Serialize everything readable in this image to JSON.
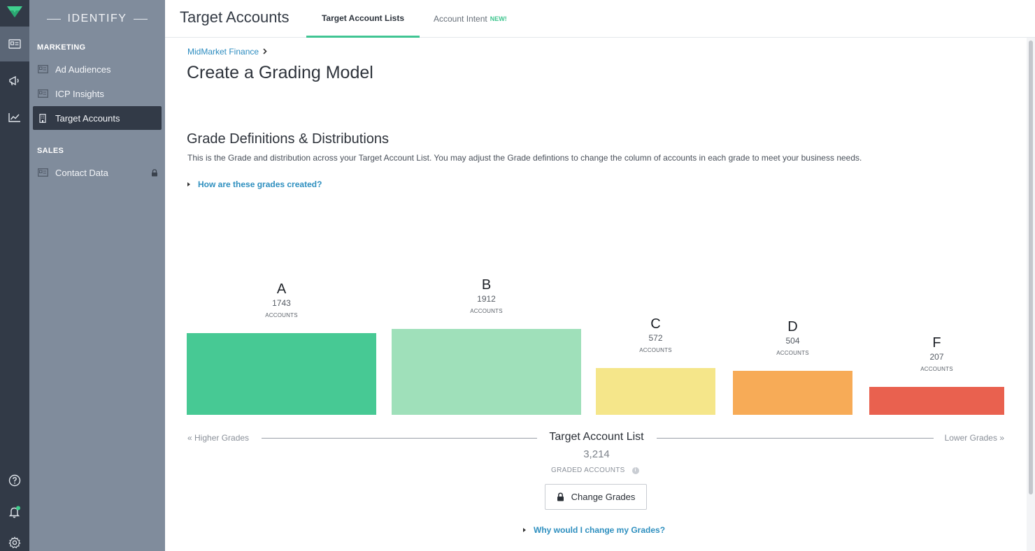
{
  "app": {
    "section_label": "IDENTIFY"
  },
  "sidebar": {
    "marketing_label": "MARKETING",
    "sales_label": "SALES",
    "items": [
      {
        "label": "Ad Audiences",
        "icon": "id-card-icon"
      },
      {
        "label": "ICP Insights",
        "icon": "id-card-icon"
      },
      {
        "label": "Target Accounts",
        "icon": "building-icon",
        "active": true
      },
      {
        "label": "Contact Data",
        "icon": "id-card-icon",
        "locked": true
      }
    ]
  },
  "header": {
    "title": "Target Accounts",
    "tabs": [
      {
        "label": "Target Account Lists",
        "active": true
      },
      {
        "label": "Account Intent",
        "badge": "NEW!"
      }
    ]
  },
  "main": {
    "breadcrumb": "MidMarket Finance",
    "page_title": "Create a Grading Model",
    "section_title": "Grade Definitions & Distributions",
    "description": "This is the Grade and distribution across your Target Account List. You may adjust the Grade defintions to change the column of accounts in each grade to meet your business needs.",
    "grades_help": "How are these grades created?",
    "higher_label": "« Higher Grades",
    "lower_label": "Lower Grades »",
    "list_label": "Target Account List",
    "total_value": "3,214",
    "total_label": "GRADED ACCOUNTS",
    "info_glyph": "i",
    "change_button": "Change Grades",
    "change_help": "Why would I change my Grades?"
  },
  "chart_data": {
    "type": "bar",
    "categories": [
      "A",
      "B",
      "C",
      "D",
      "F"
    ],
    "values": [
      1743,
      1912,
      572,
      504,
      207
    ],
    "value_unit": "ACCOUNTS",
    "colors": [
      "#47c994",
      "#9fe0ba",
      "#f5e68a",
      "#f7ab57",
      "#e9614f"
    ],
    "title": "",
    "xlabel": "Target Account List",
    "ylabel": ""
  }
}
